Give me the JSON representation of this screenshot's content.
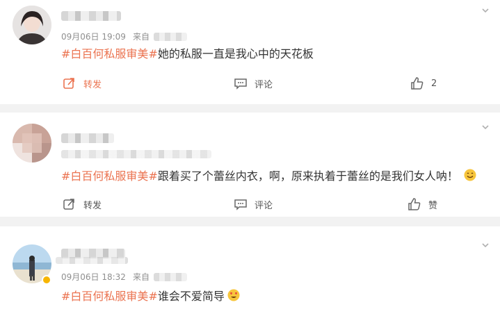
{
  "posts": [
    {
      "time": "09月06日 19:09",
      "source_prefix": "来自",
      "topic": "#白百何私服审美#",
      "text": "她的私服一直是我心中的天花板",
      "repost": "转发",
      "comment": "评论",
      "like": "2"
    },
    {
      "topic": "#白百何私服审美#",
      "text": "跟着买了个蕾丝内衣，啊，原来执着于蕾丝的是我们女人呐！",
      "repost": "转发",
      "comment": "评论",
      "like": "赞"
    },
    {
      "time": "09月06日 18:32",
      "source_prefix": "来自",
      "topic": "#白百何私服审美#",
      "text": "谁会不爱简导"
    }
  ],
  "colors": {
    "topic": "#eb7350",
    "divider": "#f2f2f2",
    "meta": "#8f8f8f"
  },
  "icons": [
    "chevron-down-icon",
    "repost-icon",
    "comment-icon",
    "like-icon",
    "smile-emoji-icon",
    "heart-eyes-emoji-icon",
    "verified-badge-icon"
  ]
}
